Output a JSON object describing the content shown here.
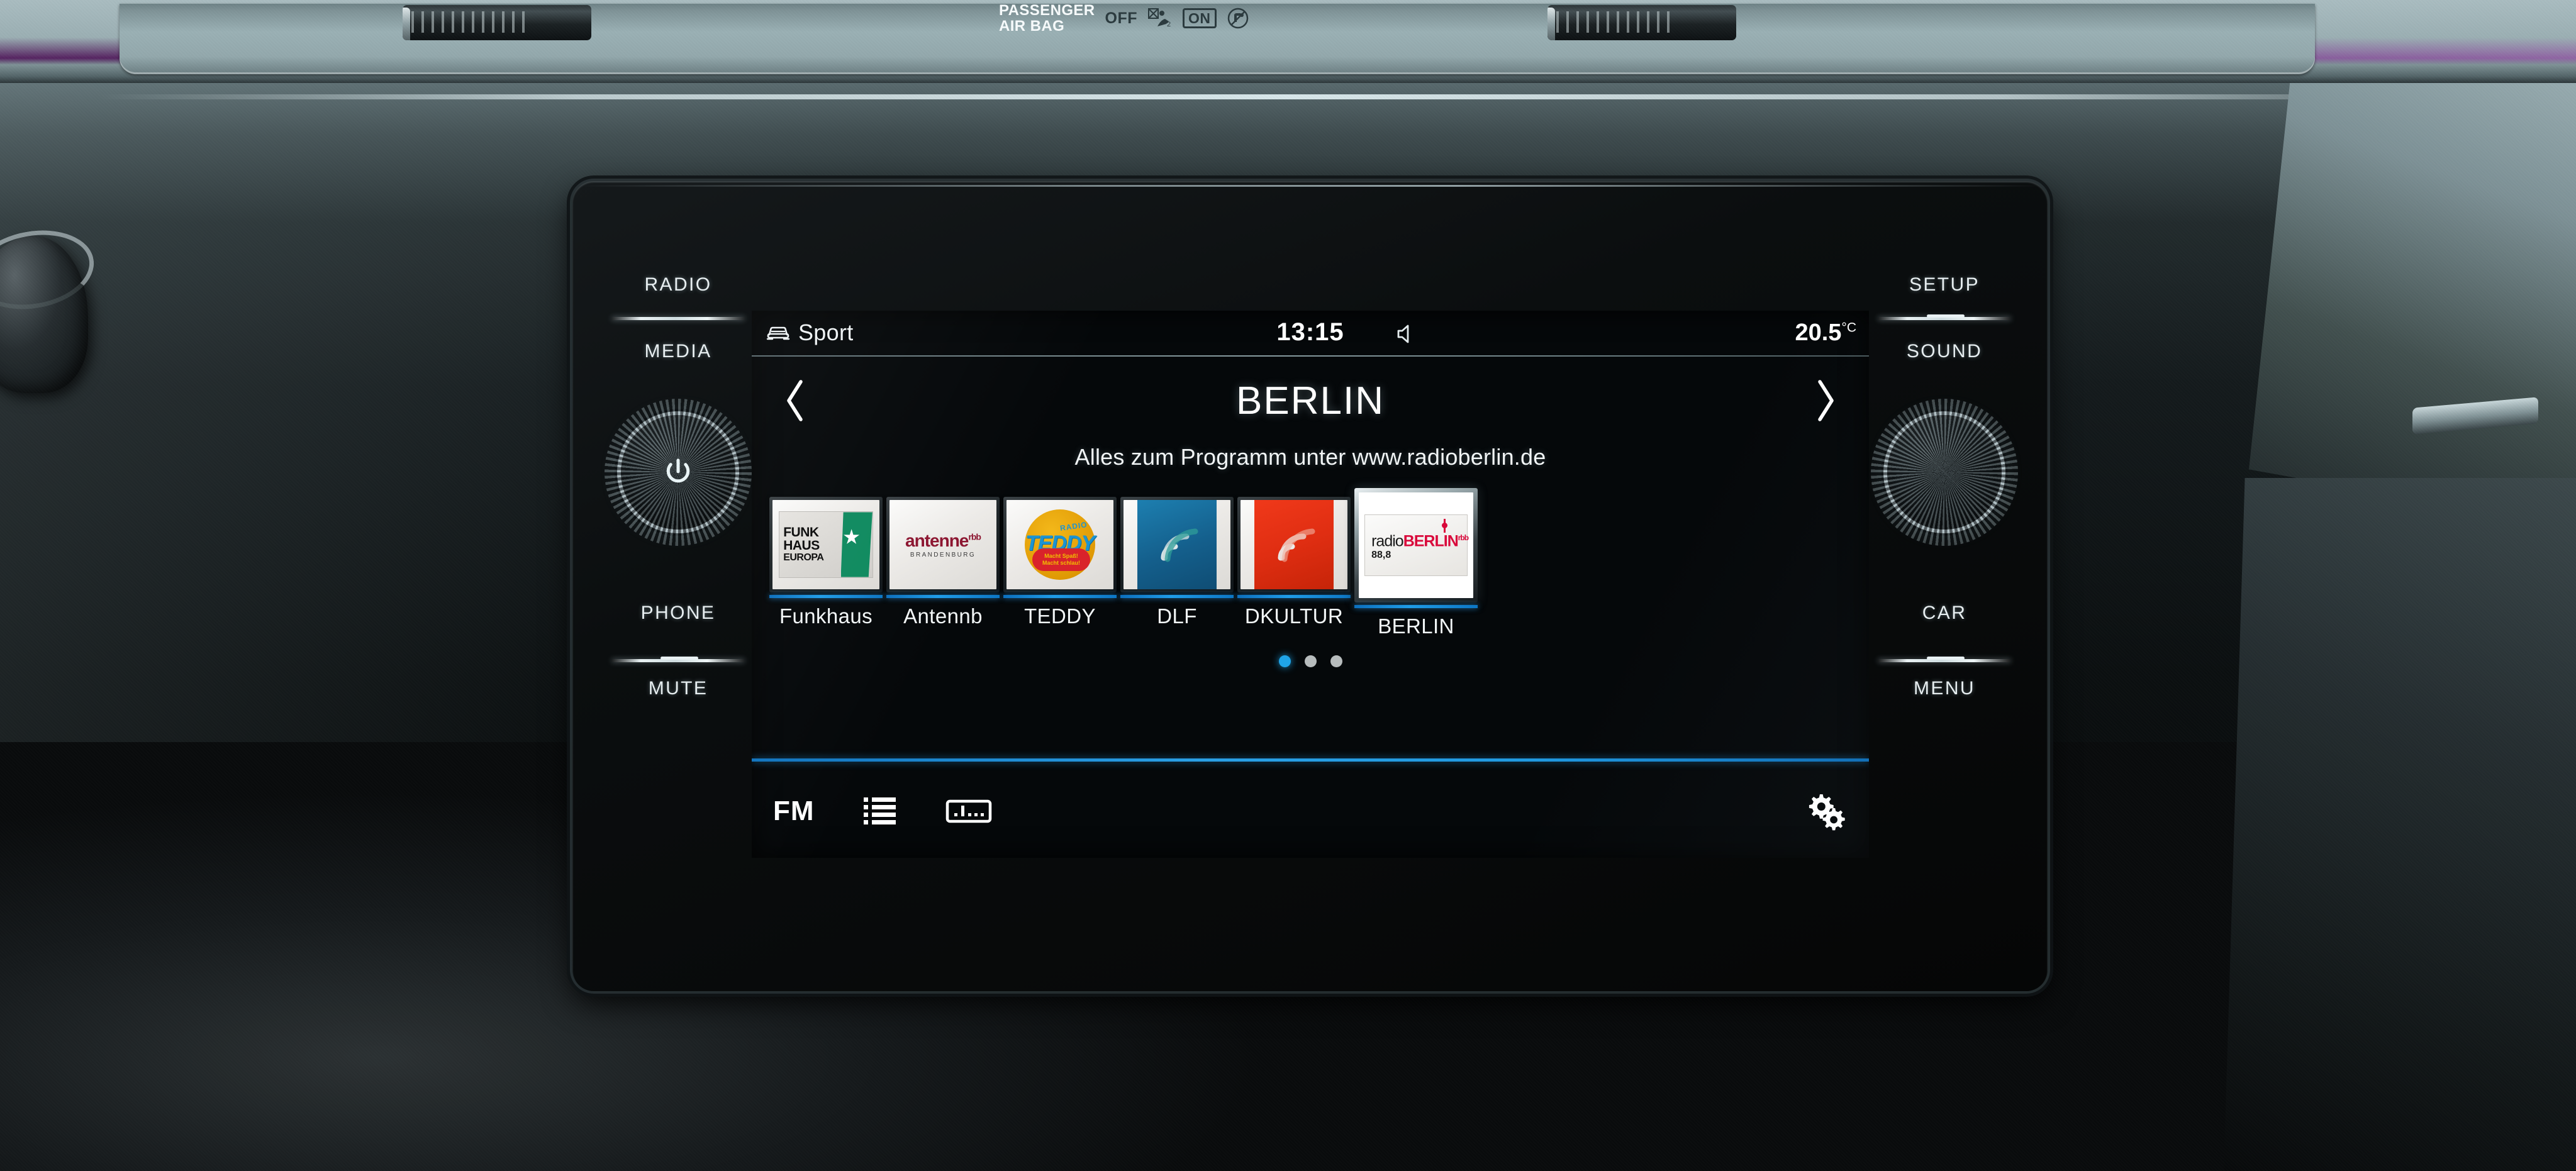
{
  "dashboard": {
    "airbag": {
      "title_line1": "PASSENGER",
      "title_line2": "AIR BAG",
      "off_label": "OFF",
      "on_label": "ON",
      "off_icon": "airbag-disabled-icon",
      "on_icon": "child-seat-prohibited-icon"
    }
  },
  "head_unit": {
    "left_buttons": [
      {
        "label": "RADIO"
      },
      {
        "label": "MEDIA"
      },
      {
        "label": "PHONE"
      },
      {
        "label": "MUTE"
      }
    ],
    "right_buttons": [
      {
        "label": "SETUP"
      },
      {
        "label": "SOUND"
      },
      {
        "label": "CAR"
      },
      {
        "label": "MENU"
      }
    ],
    "left_knob": {
      "name": "power-volume-knob",
      "icon": "power-icon"
    },
    "right_knob": {
      "name": "menu-knob",
      "icon": ""
    }
  },
  "screen": {
    "statusbar": {
      "drive_mode_icon": "car-front-icon",
      "drive_mode": "Sport",
      "clock": "13:15",
      "speaker_icon": "speaker-icon",
      "temperature": "20.5",
      "temperature_unit": "°C"
    },
    "header": {
      "prev_icon": "chevron-left-icon",
      "next_icon": "chevron-right-icon",
      "station_name": "BERLIN"
    },
    "radiotext": "Alles zum Programm unter www.radioberlin.de",
    "presets": [
      {
        "name": "Funkhaus",
        "logo": "funkhaus-europa-logo",
        "logo_text": {
          "l1": "FUNK",
          "l2": "HAUS",
          "l3": "EUROPA"
        },
        "selected": false
      },
      {
        "name": "Antennb",
        "logo": "antenne-brandenburg-logo",
        "logo_text": {
          "main": "antenne",
          "sup": "rbb",
          "sub": "BRANDENBURG"
        },
        "selected": false
      },
      {
        "name": "TEDDY",
        "logo": "radio-teddy-logo",
        "logo_text": {
          "radio": "RADIO",
          "teddy": "TEDDY",
          "slogan1": "Macht Spaß!",
          "slogan2": "Macht schlau!"
        },
        "selected": false
      },
      {
        "name": "DLF",
        "logo": "deutschlandfunk-logo",
        "logo_text": {},
        "selected": false
      },
      {
        "name": "DKULTUR",
        "logo": "deutschlandfunk-kultur-logo",
        "logo_text": {},
        "selected": false
      },
      {
        "name": "BERLIN",
        "logo": "radio-berlin-rbb-logo",
        "logo_text": {
          "radio": "radio",
          "berlin": "BERLIN",
          "sup": "rbb",
          "freq": "88,8"
        },
        "selected": true
      }
    ],
    "pagination": {
      "total": 3,
      "active_index": 0
    },
    "bottombar": {
      "band_label": "FM",
      "list_icon": "station-list-icon",
      "tuner_icon": "tuner-scale-icon",
      "settings_icon": "gears-icon"
    }
  },
  "colors": {
    "accent_blue": "#1f9ce8",
    "preset_accent": "#0d76c4",
    "screen_bg": "#05080a",
    "text_primary": "#ffffff"
  }
}
